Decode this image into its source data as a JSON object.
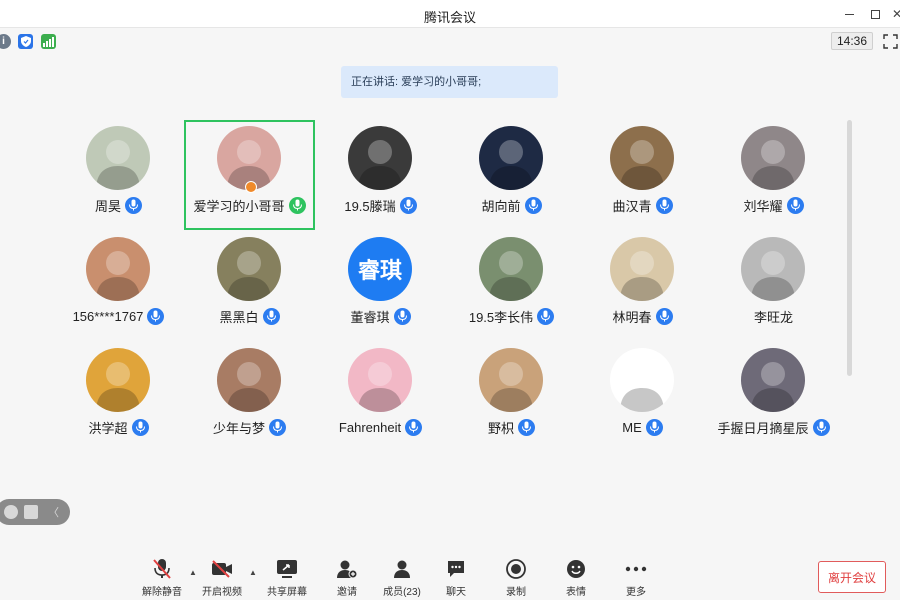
{
  "window": {
    "title": "腾讯会议"
  },
  "infobar": {
    "timer": "14:36"
  },
  "speaking_banner": "正在讲话: 爱学习的小哥哥;",
  "participants": [
    {
      "name": "周昊",
      "avatar": "panda",
      "bg": "#bfc9b7",
      "mic": "on"
    },
    {
      "name": "爱学习的小哥哥",
      "avatar": "girl",
      "bg": "#d9a6a0",
      "mic": "speaking",
      "host": true,
      "active": true
    },
    {
      "name": "19.5滕瑞",
      "avatar": "portrait-bw",
      "bg": "#3a3a3a",
      "mic": "on"
    },
    {
      "name": "胡向前",
      "avatar": "moon",
      "bg": "#1e2a44",
      "mic": "on"
    },
    {
      "name": "曲汉青",
      "avatar": "building",
      "bg": "#8d6f4c",
      "mic": "on"
    },
    {
      "name": "刘华耀",
      "avatar": "figure",
      "bg": "#8f8789",
      "mic": "on"
    },
    {
      "name": "156****1767",
      "avatar": "child",
      "bg": "#c98f6e",
      "mic": "on"
    },
    {
      "name": "黑黑白",
      "avatar": "crowd",
      "bg": "#86805e",
      "mic": "on"
    },
    {
      "name": "董睿琪",
      "avatar": "text",
      "avatar_text": "睿琪",
      "bg": "#1e7cf2",
      "mic": "on"
    },
    {
      "name": "19.5李长伟",
      "avatar": "boy",
      "bg": "#7a8f6f",
      "mic": "on"
    },
    {
      "name": "林明春",
      "avatar": "anime",
      "bg": "#d9c8a8",
      "mic": "on"
    },
    {
      "name": "李旺龙",
      "avatar": "sketch",
      "bg": "#b9b9b9",
      "mic": "none"
    },
    {
      "name": "洪学超",
      "avatar": "cartoon-jay",
      "bg": "#e0a43a",
      "mic": "on"
    },
    {
      "name": "少年与梦",
      "avatar": "chin",
      "bg": "#a87c64",
      "mic": "on"
    },
    {
      "name": "Fahrenheit",
      "avatar": "cartoon-girl",
      "bg": "#f2b8c6",
      "mic": "on"
    },
    {
      "name": "野枳",
      "avatar": "baby-santa",
      "bg": "#c9a27a",
      "mic": "on"
    },
    {
      "name": "ME",
      "avatar": "doodle",
      "bg": "#ffffff",
      "mic": "on"
    },
    {
      "name": "手握日月摘星辰",
      "avatar": "anime-boy",
      "bg": "#6e6a78",
      "mic": "on"
    }
  ],
  "toolbar": {
    "unmute": "解除静音",
    "start_video": "开启视频",
    "share_screen": "共享屏幕",
    "invite": "邀请",
    "members": "成员(23)",
    "chat": "聊天",
    "record": "录制",
    "emoji": "表情",
    "more": "更多",
    "leave": "离开会议"
  },
  "colors": {
    "accent": "#2c7cf0",
    "active_border": "#2ec35f",
    "leave": "#e04040"
  }
}
